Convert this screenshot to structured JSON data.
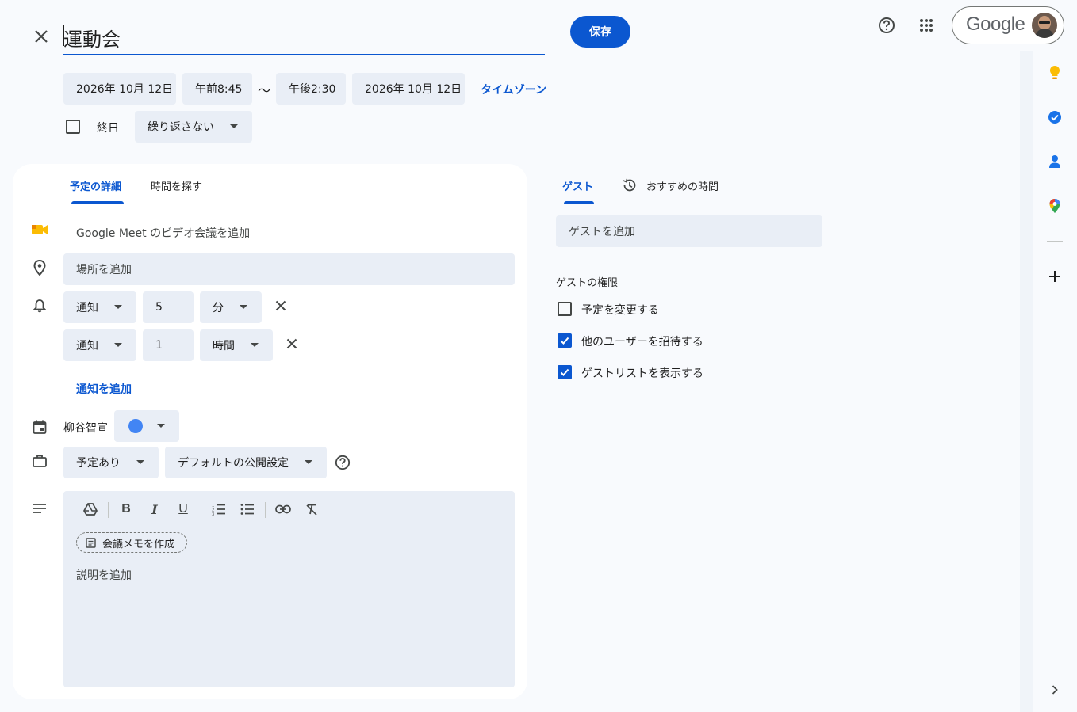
{
  "title": "運動会",
  "save_label": "保存",
  "google_label": "Google",
  "date_start": "2026年 10月 12日",
  "time_start": "午前8:45",
  "tilde": "〜",
  "time_end": "午後2:30",
  "date_end": "2026年 10月 12日",
  "timezone_label": "タイムゾーン",
  "allday_label": "終日",
  "repeat_label": "繰り返さない",
  "tabs": {
    "details": "予定の詳細",
    "find_time": "時間を探す",
    "guests": "ゲスト",
    "suggested": "おすすめの時間"
  },
  "meet_label": "Google Meet のビデオ会議を追加",
  "location_placeholder": "場所を追加",
  "notifications": [
    {
      "type": "通知",
      "value": "5",
      "unit": "分"
    },
    {
      "type": "通知",
      "value": "1",
      "unit": "時間"
    }
  ],
  "add_notification_label": "通知を追加",
  "calendar_owner": "柳谷智宣",
  "calendar_color": "#4285f4",
  "availability_label": "予定あり",
  "visibility_label": "デフォルトの公開設定",
  "meeting_notes_label": "会議メモを作成",
  "description_placeholder": "説明を追加",
  "guest_placeholder": "ゲストを追加",
  "permissions_title": "ゲストの権限",
  "permissions": [
    {
      "label": "予定を変更する",
      "checked": false
    },
    {
      "label": "他のユーザーを招待する",
      "checked": true
    },
    {
      "label": "ゲストリストを表示する",
      "checked": true
    }
  ],
  "colors": {
    "accent": "#0b57d0",
    "chip_bg": "#e9eef6",
    "page_bg": "#f8fafd"
  }
}
